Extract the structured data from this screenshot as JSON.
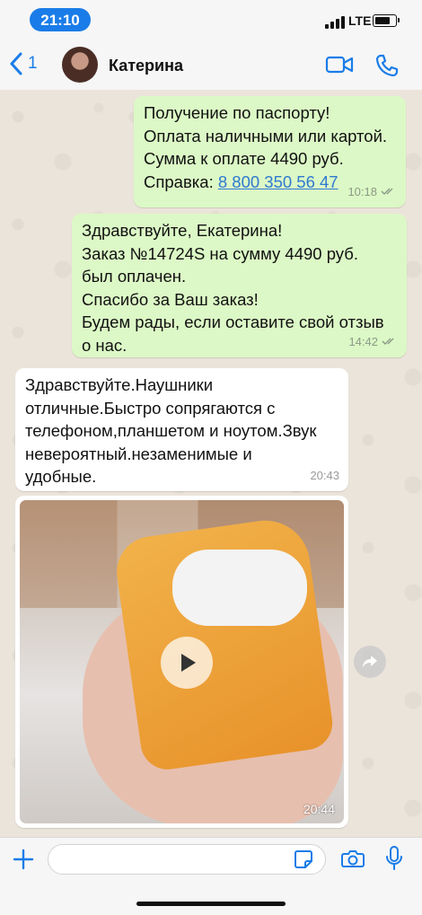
{
  "status_bar": {
    "time": "21:10",
    "network": "LTE"
  },
  "header": {
    "back_count": "1",
    "contact_name": "Катерина"
  },
  "messages": [
    {
      "direction": "outgoing",
      "lines": [
        "Получение по паспорту!",
        "Оплата наличными или картой.",
        "Сумма к оплате 4490 руб."
      ],
      "link_prefix": "Справка: ",
      "link_text": "8 800 350 56 47",
      "time": "10:18"
    },
    {
      "direction": "outgoing",
      "lines": [
        "Здравствуйте, Екатерина!",
        "Заказ №14724S на сумму 4490 руб.",
        "был оплачен.",
        "Спасибо за Ваш заказ!",
        "Будем рады, если оставите свой отзыв",
        "о нас."
      ],
      "time": "14:42"
    },
    {
      "direction": "incoming",
      "lines": [
        "Здравствуйте.Наушники",
        "отличные.Быстро сопрягаются с",
        "телефоном,планшетом и ноутом.Звук",
        "невероятный.незаменимые и",
        "удобные."
      ],
      "time": "20:43"
    },
    {
      "direction": "incoming",
      "type": "video",
      "time": "20:44"
    }
  ],
  "input": {
    "placeholder": ""
  },
  "icons": {
    "back": "chevron-left-icon",
    "video_call": "video-camera-icon",
    "voice_call": "phone-icon",
    "read_receipt": "double-check-icon",
    "play": "play-icon",
    "forward": "forward-icon",
    "attach": "plus-icon",
    "sticker": "sticker-icon",
    "camera": "camera-icon",
    "microphone": "microphone-icon"
  },
  "colors": {
    "accent": "#1a7ce8",
    "outgoing_bubble": "#dcf8c6",
    "incoming_bubble": "#ffffff"
  }
}
